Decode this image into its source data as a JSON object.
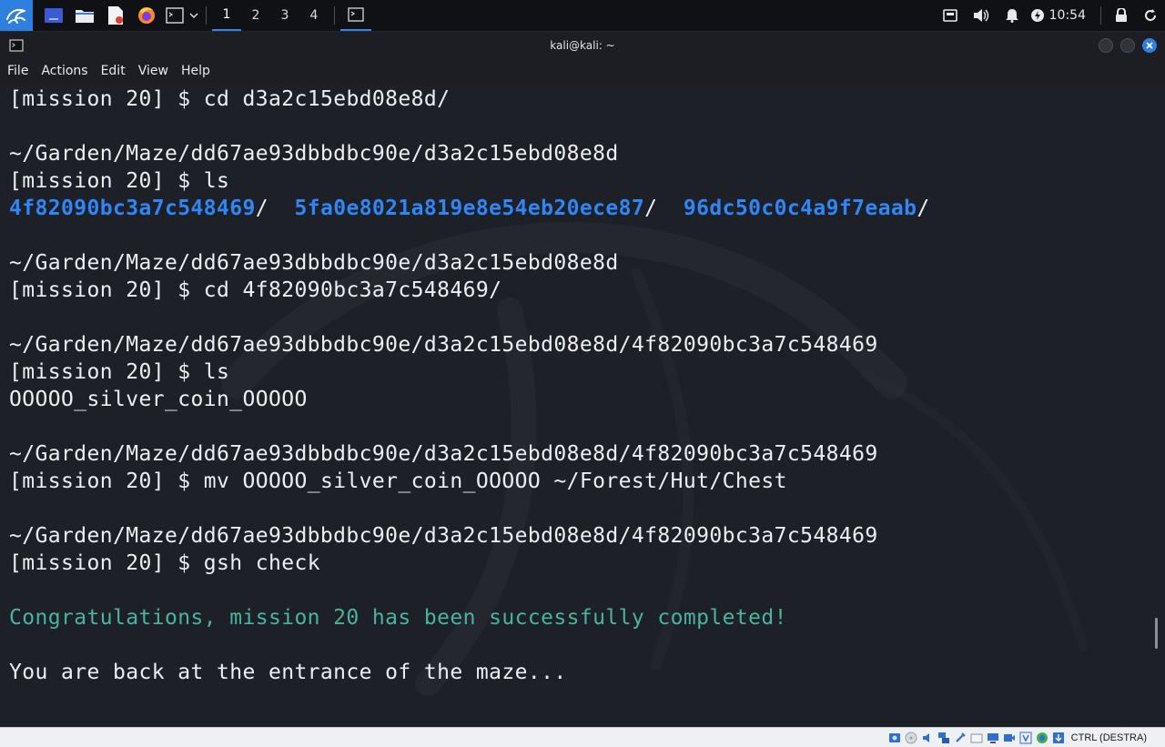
{
  "taskbar": {
    "workspaces": [
      "1",
      "2",
      "3",
      "4"
    ],
    "active_workspace": "1",
    "clock": "10:54"
  },
  "window": {
    "title": "kali@kali: ~"
  },
  "menubar": {
    "items": [
      "File",
      "Actions",
      "Edit",
      "View",
      "Help"
    ]
  },
  "terminal": {
    "lines": [
      {
        "type": "cmd",
        "prompt": "[mission 20] $ ",
        "command": "cd d3a2c15ebd08e8d/"
      },
      {
        "type": "blank"
      },
      {
        "type": "path",
        "text": "~/Garden/Maze/dd67ae93dbbdbc90e/d3a2c15ebd08e8d"
      },
      {
        "type": "cmd",
        "prompt": "[mission 20] $ ",
        "command": "ls"
      },
      {
        "type": "dirs",
        "entries": [
          "4f82090bc3a7c548469",
          "5fa0e8021a819e8e54eb20ece87",
          "96dc50c0c4a9f7eaab"
        ]
      },
      {
        "type": "blank"
      },
      {
        "type": "path",
        "text": "~/Garden/Maze/dd67ae93dbbdbc90e/d3a2c15ebd08e8d"
      },
      {
        "type": "cmd",
        "prompt": "[mission 20] $ ",
        "command": "cd 4f82090bc3a7c548469/"
      },
      {
        "type": "blank"
      },
      {
        "type": "path",
        "text": "~/Garden/Maze/dd67ae93dbbdbc90e/d3a2c15ebd08e8d/4f82090bc3a7c548469"
      },
      {
        "type": "cmd",
        "prompt": "[mission 20] $ ",
        "command": "ls"
      },
      {
        "type": "output",
        "text": "OOOOO_silver_coin_OOOOO"
      },
      {
        "type": "blank"
      },
      {
        "type": "path",
        "text": "~/Garden/Maze/dd67ae93dbbdbc90e/d3a2c15ebd08e8d/4f82090bc3a7c548469"
      },
      {
        "type": "cmd",
        "prompt": "[mission 20] $ ",
        "command": "mv OOOOO_silver_coin_OOOOO ~/Forest/Hut/Chest"
      },
      {
        "type": "blank"
      },
      {
        "type": "path",
        "text": "~/Garden/Maze/dd67ae93dbbdbc90e/d3a2c15ebd08e8d/4f82090bc3a7c548469"
      },
      {
        "type": "cmd",
        "prompt": "[mission 20] $ ",
        "command": "gsh check"
      },
      {
        "type": "blank"
      },
      {
        "type": "success",
        "text": "Congratulations, mission 20 has been successfully completed!"
      },
      {
        "type": "blank"
      },
      {
        "type": "output",
        "text": "You are back at the entrance of the maze..."
      }
    ]
  },
  "statusbar": {
    "host_key": "CTRL (DESTRA)"
  },
  "colors": {
    "directory": "#2f86f6",
    "success": "#47b3a0",
    "close_button": "#2f7fe0",
    "active_workspace": "#3a84e8"
  }
}
